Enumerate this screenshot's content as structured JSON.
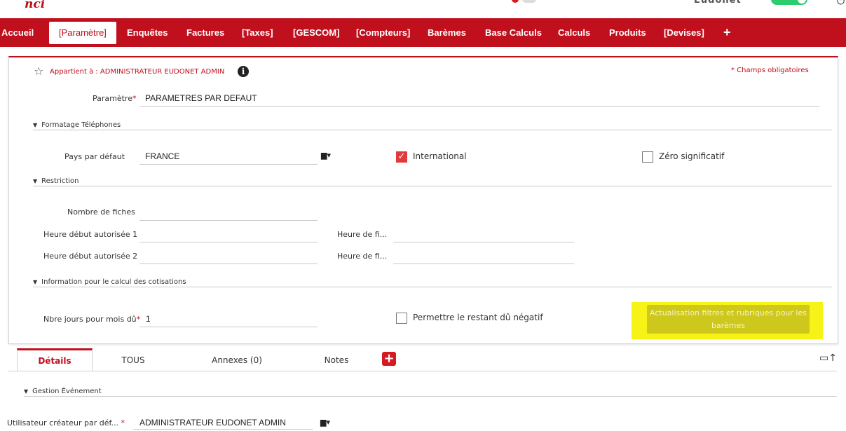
{
  "app": {
    "logo_text": "nci",
    "user_text": "Eudonet"
  },
  "nav": {
    "tabs": [
      {
        "label": "Accueil",
        "active": false
      },
      {
        "label": "[Paramètre]",
        "active": true
      },
      {
        "label": "Enquêtes",
        "active": false
      },
      {
        "label": "Factures",
        "active": false
      },
      {
        "label": "[Taxes]",
        "active": false
      },
      {
        "label": "[GESCOM]",
        "active": false
      },
      {
        "label": "[Compteurs]",
        "active": false
      },
      {
        "label": "Barèmes",
        "active": false
      },
      {
        "label": "Base Calculs",
        "active": false
      },
      {
        "label": "Calculs",
        "active": false
      },
      {
        "label": "Produits",
        "active": false
      },
      {
        "label": "[Devises]",
        "active": false
      }
    ],
    "add_label": "+"
  },
  "header": {
    "owner": "Appartient à : ADMINISTRATEUR EUDONET ADMIN",
    "required_note": "* Champs obligatoires"
  },
  "fields": {
    "parametre": {
      "label": "Paramètre",
      "required_mark": "*",
      "value": "PARAMETRES PAR DEFAUT"
    }
  },
  "sections": {
    "telephones": {
      "title": "Formatage Téléphones",
      "pays_label": "Pays par défaut",
      "pays_value": "FRANCE",
      "international_label": "International",
      "international_checked": true,
      "zero_label": "Zéro significatif",
      "zero_checked": false
    },
    "restriction": {
      "title": "Restriction",
      "nombre_label": "Nombre de fiches",
      "nombre_value": "",
      "debut1_label": "Heure début autorisée 1",
      "debut1_value": "",
      "fin1_label": "Heure de fi...",
      "fin1_value": "",
      "debut2_label": "Heure début autorisée 2",
      "debut2_value": "",
      "fin2_label": "Heure de fi...",
      "fin2_value": ""
    },
    "cotisations": {
      "title": "Information pour le calcul des cotisations",
      "jours_label": "Nbre jours pour mois dû",
      "jours_required": "*",
      "jours_value": "1",
      "negatif_label": "Permettre le restant dû négatif",
      "negatif_checked": false,
      "action_button": "Actualisation filtres et rubriques pour les barèmes"
    }
  },
  "detail_tabs": {
    "tabs": [
      {
        "label": "Détails",
        "active": true
      },
      {
        "label": "TOUS",
        "active": false
      },
      {
        "label": "Annexes (0)",
        "active": false
      },
      {
        "label": "Notes",
        "active": false
      }
    ],
    "add_label": "+"
  },
  "gestion": {
    "title": "Gestion Événement",
    "createur_label": "Utilisateur créateur par déf...",
    "createur_required": "*",
    "createur_value": "ADMINISTRATEUR EUDONET ADMIN"
  },
  "colors": {
    "brand_red": "#c00f1d",
    "highlight_yellow": "#f7f316",
    "toggle_green": "#2ecc71"
  },
  "icons": [
    "star-icon",
    "info-icon",
    "folder-icon",
    "checkbox-checked-icon",
    "checkbox-icon",
    "add-tab-icon",
    "panel-toggle-icon",
    "logout-icon"
  ]
}
